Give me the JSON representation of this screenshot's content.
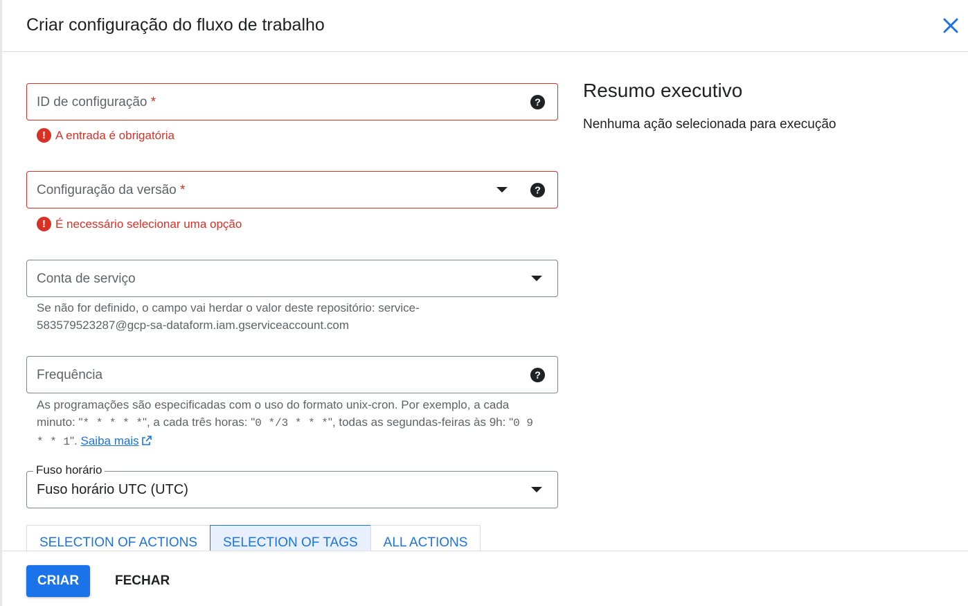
{
  "dialog": {
    "title": "Criar configuração do fluxo de trabalho"
  },
  "form": {
    "config_id": {
      "label": "ID de configuração",
      "required_marker": "*",
      "error": "A entrada é obrigatória"
    },
    "version_config": {
      "label": "Configuração da versão",
      "required_marker": "*",
      "error": "É necessário selecionar uma opção"
    },
    "service_account": {
      "label": "Conta de serviço",
      "hint_line1": "Se não for definido, o campo vai herdar o valor deste repositório: service-",
      "hint_line2": "583579523287@gcp-sa-dataform.iam.gserviceaccount.com"
    },
    "frequency": {
      "label": "Frequência",
      "hint_a": "As programações são especificadas com o uso do formato unix-cron. Por exemplo, a cada minuto: \"",
      "cron_every_minute": "* * * * *",
      "hint_b": "\", a cada três horas: \"",
      "cron_every_three_hours": "0 */3 * * *",
      "hint_c": "\", todas as segundas-feiras às 9h: \"",
      "cron_mondays": "0 9 * * 1",
      "hint_d": "\". ",
      "learn_more": "Saiba mais"
    },
    "timezone": {
      "label": "Fuso horário",
      "value": "Fuso horário UTC (UTC)"
    },
    "tabs": [
      {
        "label": "SELECTION OF ACTIONS",
        "active": false
      },
      {
        "label": "SELECTION OF TAGS",
        "active": true
      },
      {
        "label": "ALL ACTIONS",
        "active": false
      }
    ]
  },
  "summary": {
    "title": "Resumo executivo",
    "text": "Nenhuma ação selecionada para execução"
  },
  "footer": {
    "create_label": "CRIAR",
    "close_label": "FECHAR"
  },
  "colors": {
    "primary": "#1a73e8",
    "error": "#d93025",
    "active_tab_bg": "#e8f0fe"
  }
}
